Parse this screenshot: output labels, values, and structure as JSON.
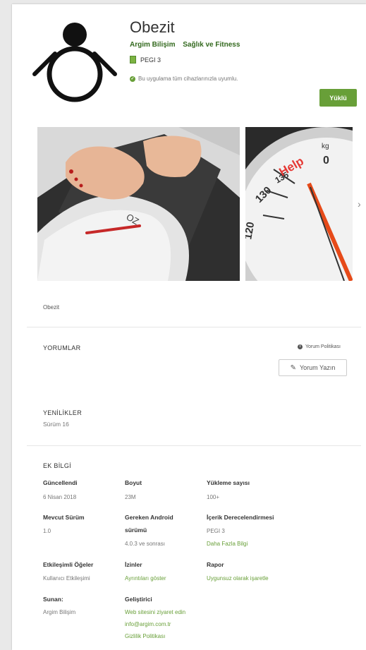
{
  "app": {
    "title": "Obezit",
    "developer": "Argim Bilişim",
    "category": "Sağlık ve Fitness",
    "rating": "PEGI 3",
    "compatibility": "Bu uygulama tüm cihazlarınızla uyumlu.",
    "install_label": "Yüklü"
  },
  "screenshots": {
    "scale_text_1": "OZ",
    "scale_text_2": "135",
    "scale_text_3": "130",
    "scale_text_4": "120",
    "scale_help": "Help",
    "scale_kg": "kg",
    "scale_zero": "0"
  },
  "description": "Obezit",
  "reviews": {
    "heading": "YORUMLAR",
    "policy_label": "Yorum Politikası",
    "write_label": "Yorum Yazın"
  },
  "whats_new": {
    "heading": "YENİLİKLER",
    "text": "Sürüm 16"
  },
  "extra_info": {
    "heading": "EK BİLGİ",
    "updated_label": "Güncellendi",
    "updated_value": "6 Nisan 2018",
    "size_label": "Boyut",
    "size_value": "23M",
    "installs_label": "Yükleme sayısı",
    "installs_value": "100+",
    "version_label": "Mevcut Sürüm",
    "version_value": "1.0",
    "android_label_1": "Gereken Android",
    "android_label_2": "sürümü",
    "android_value": "4.0.3 ve sonrası",
    "content_label": "İçerik Derecelendirmesi",
    "content_value": "PEGI 3",
    "content_link": "Daha Fazla Bilgi",
    "interactive_label": "Etkileşimli Öğeler",
    "interactive_value": "Kullanıcı Etkileşimi",
    "permissions_label": "İzinler",
    "permissions_link": "Ayrıntıları göster",
    "report_label": "Rapor",
    "report_link": "Uygunsuz olarak işaretle",
    "offered_label": "Sunan:",
    "offered_value": "Argim Bilişim",
    "developer_label": "Geliştirici",
    "website_link": "Web sitesini ziyaret edin",
    "email_link": "info@argim.com.tr",
    "privacy_link": "Gizlilik Politikası"
  },
  "colors": {
    "accent": "#689f38",
    "dev_text": "#33691e"
  }
}
